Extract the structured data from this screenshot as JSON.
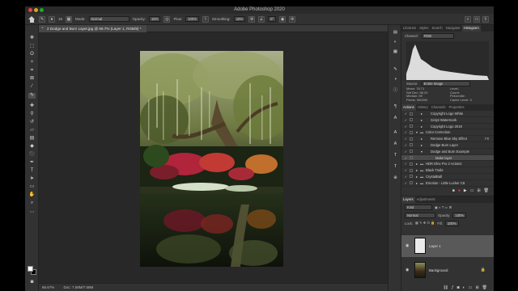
{
  "window": {
    "title": "Adobe Photoshop 2020"
  },
  "options_bar": {
    "brush_size": "16",
    "mode_label": "Mode:",
    "mode_value": "Normal",
    "opacity_label": "Opacity:",
    "opacity_value": "15%",
    "flow_label": "Flow:",
    "flow_value": "100%",
    "smoothing_label": "Smoothing:",
    "smoothing_value": "10%",
    "angle_value": "0°"
  },
  "document": {
    "tab_label": "2 Dodge and Burn Layer.jpg @ 66.7% (Layer 1, RGB/8) *",
    "zoom": "66.67%",
    "doc_size": "Doc: 7.58M/7.58M"
  },
  "histogram_panel": {
    "tabs": [
      "Libraries",
      "Styles",
      "Search",
      "Navigator",
      "Histogram"
    ],
    "active_tab": "Histogram",
    "channel_label": "Channel:",
    "channel_value": "RGB",
    "source_label": "Source:",
    "source_value": "Entire Image",
    "stats_left": [
      "Mean: 78.71",
      "Std Dev: 58.20",
      "Median: 59",
      "Pixels: 960000"
    ],
    "stats_right": [
      "Level:",
      "Count:",
      "Percentile:",
      "Cache Level: 3"
    ]
  },
  "actions_panel": {
    "tabs": [
      "Actions",
      "History",
      "Channels",
      "Properties"
    ],
    "active_tab": "Actions",
    "items": [
      {
        "label": "Copyright Logo White",
        "indent": 1,
        "expand": "▸",
        "checked": true,
        "folder": false
      },
      {
        "label": "Script Watermark",
        "indent": 1,
        "expand": "▸",
        "checked": true,
        "folder": false
      },
      {
        "label": "Copyright Logo 2019",
        "indent": 1,
        "expand": "▸",
        "checked": true,
        "folder": false
      },
      {
        "label": "Color Correction",
        "indent": 0,
        "expand": "▾",
        "checked": true,
        "folder": true
      },
      {
        "label": "Remove Blue Sky Effect",
        "indent": 1,
        "expand": "▸",
        "checked": true,
        "folder": false,
        "tail": "F8"
      },
      {
        "label": "Dodge Burn Layer",
        "indent": 1,
        "expand": "▸",
        "checked": true,
        "folder": false
      },
      {
        "label": "Dodge and Burn Example",
        "indent": 1,
        "expand": "▾",
        "checked": true,
        "folder": false
      },
      {
        "label": "Make layer",
        "indent": 2,
        "expand": "",
        "checked": true,
        "folder": false,
        "selected": true
      },
      {
        "label": "HDR Efex Pro 2 Actions",
        "indent": 0,
        "expand": "▸",
        "checked": true,
        "folder": true
      },
      {
        "label": "Black Trails",
        "indent": 0,
        "expand": "▸",
        "checked": true,
        "folder": true
      },
      {
        "label": "CrystalBall",
        "indent": 0,
        "expand": "▸",
        "checked": true,
        "folder": true
      },
      {
        "label": "Emotion - Little Lucker C6",
        "indent": 0,
        "expand": "▸",
        "checked": true,
        "folder": true
      }
    ]
  },
  "layers_panel": {
    "tabs": [
      "Layers",
      "Adjustments"
    ],
    "active_tab": "Layers",
    "kind_label": "Kind",
    "blend_mode": "Normal",
    "opacity_label": "Opacity:",
    "opacity_value": "100%",
    "lock_label": "Lock:",
    "fill_label": "Fill:",
    "fill_value": "100%",
    "layers": [
      {
        "name": "Layer 1",
        "selected": true,
        "visible": true
      },
      {
        "name": "Background",
        "selected": false,
        "visible": true,
        "locked": true
      }
    ]
  },
  "colors": {
    "accent": "#2d7de0",
    "record": "#e04040",
    "foreground_swatch": "#ffffff",
    "background_swatch": "#000000"
  }
}
